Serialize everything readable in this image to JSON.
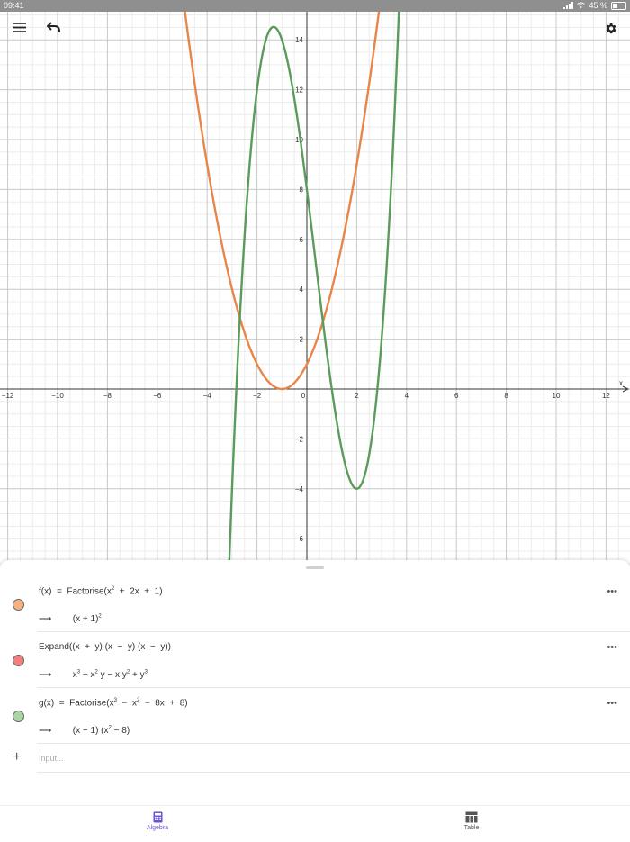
{
  "status": {
    "time": "09:41",
    "battery": "45 %"
  },
  "toolbar": {
    "menu_icon": "hamburger-menu-icon",
    "undo_icon": "undo-icon",
    "settings_icon": "gear-icon"
  },
  "graph": {
    "x_ticks": [
      "−12",
      "−10",
      "−8",
      "−6",
      "−4",
      "−2",
      "0",
      "2",
      "4",
      "6",
      "8",
      "10",
      "12"
    ],
    "y_ticks": [
      "14",
      "12",
      "10",
      "8",
      "6",
      "4",
      "2",
      "−2",
      "−4",
      "−6"
    ],
    "x_axis_label": "x",
    "series": [
      {
        "label": "f(x) = (x + 1)²",
        "color": "#e8864a"
      },
      {
        "label": "g(x) = (x − 1)(x² − 8)",
        "color": "#5b9b5b"
      }
    ]
  },
  "algebra": {
    "rows": [
      {
        "color": "#f4b183",
        "input": "f(x)  =  Factorise(x² + 2x + 1)",
        "output": "(x + 1)²"
      },
      {
        "color": "#f08080",
        "input": "Expand((x + y) (x − y) (x − y))",
        "output": "x³ − x² y − x y² + y³"
      },
      {
        "color": "#a8d5a2",
        "input": "g(x)  =  Factorise(x³ − x² − 8x + 8)",
        "output": "(x − 1) (x² − 8)"
      }
    ],
    "arrow": "⟶",
    "more": "•••",
    "input_placeholder": "Input..."
  },
  "nav": {
    "algebra_label": "Algebra",
    "table_label": "Table",
    "active_color": "#6557d2"
  }
}
